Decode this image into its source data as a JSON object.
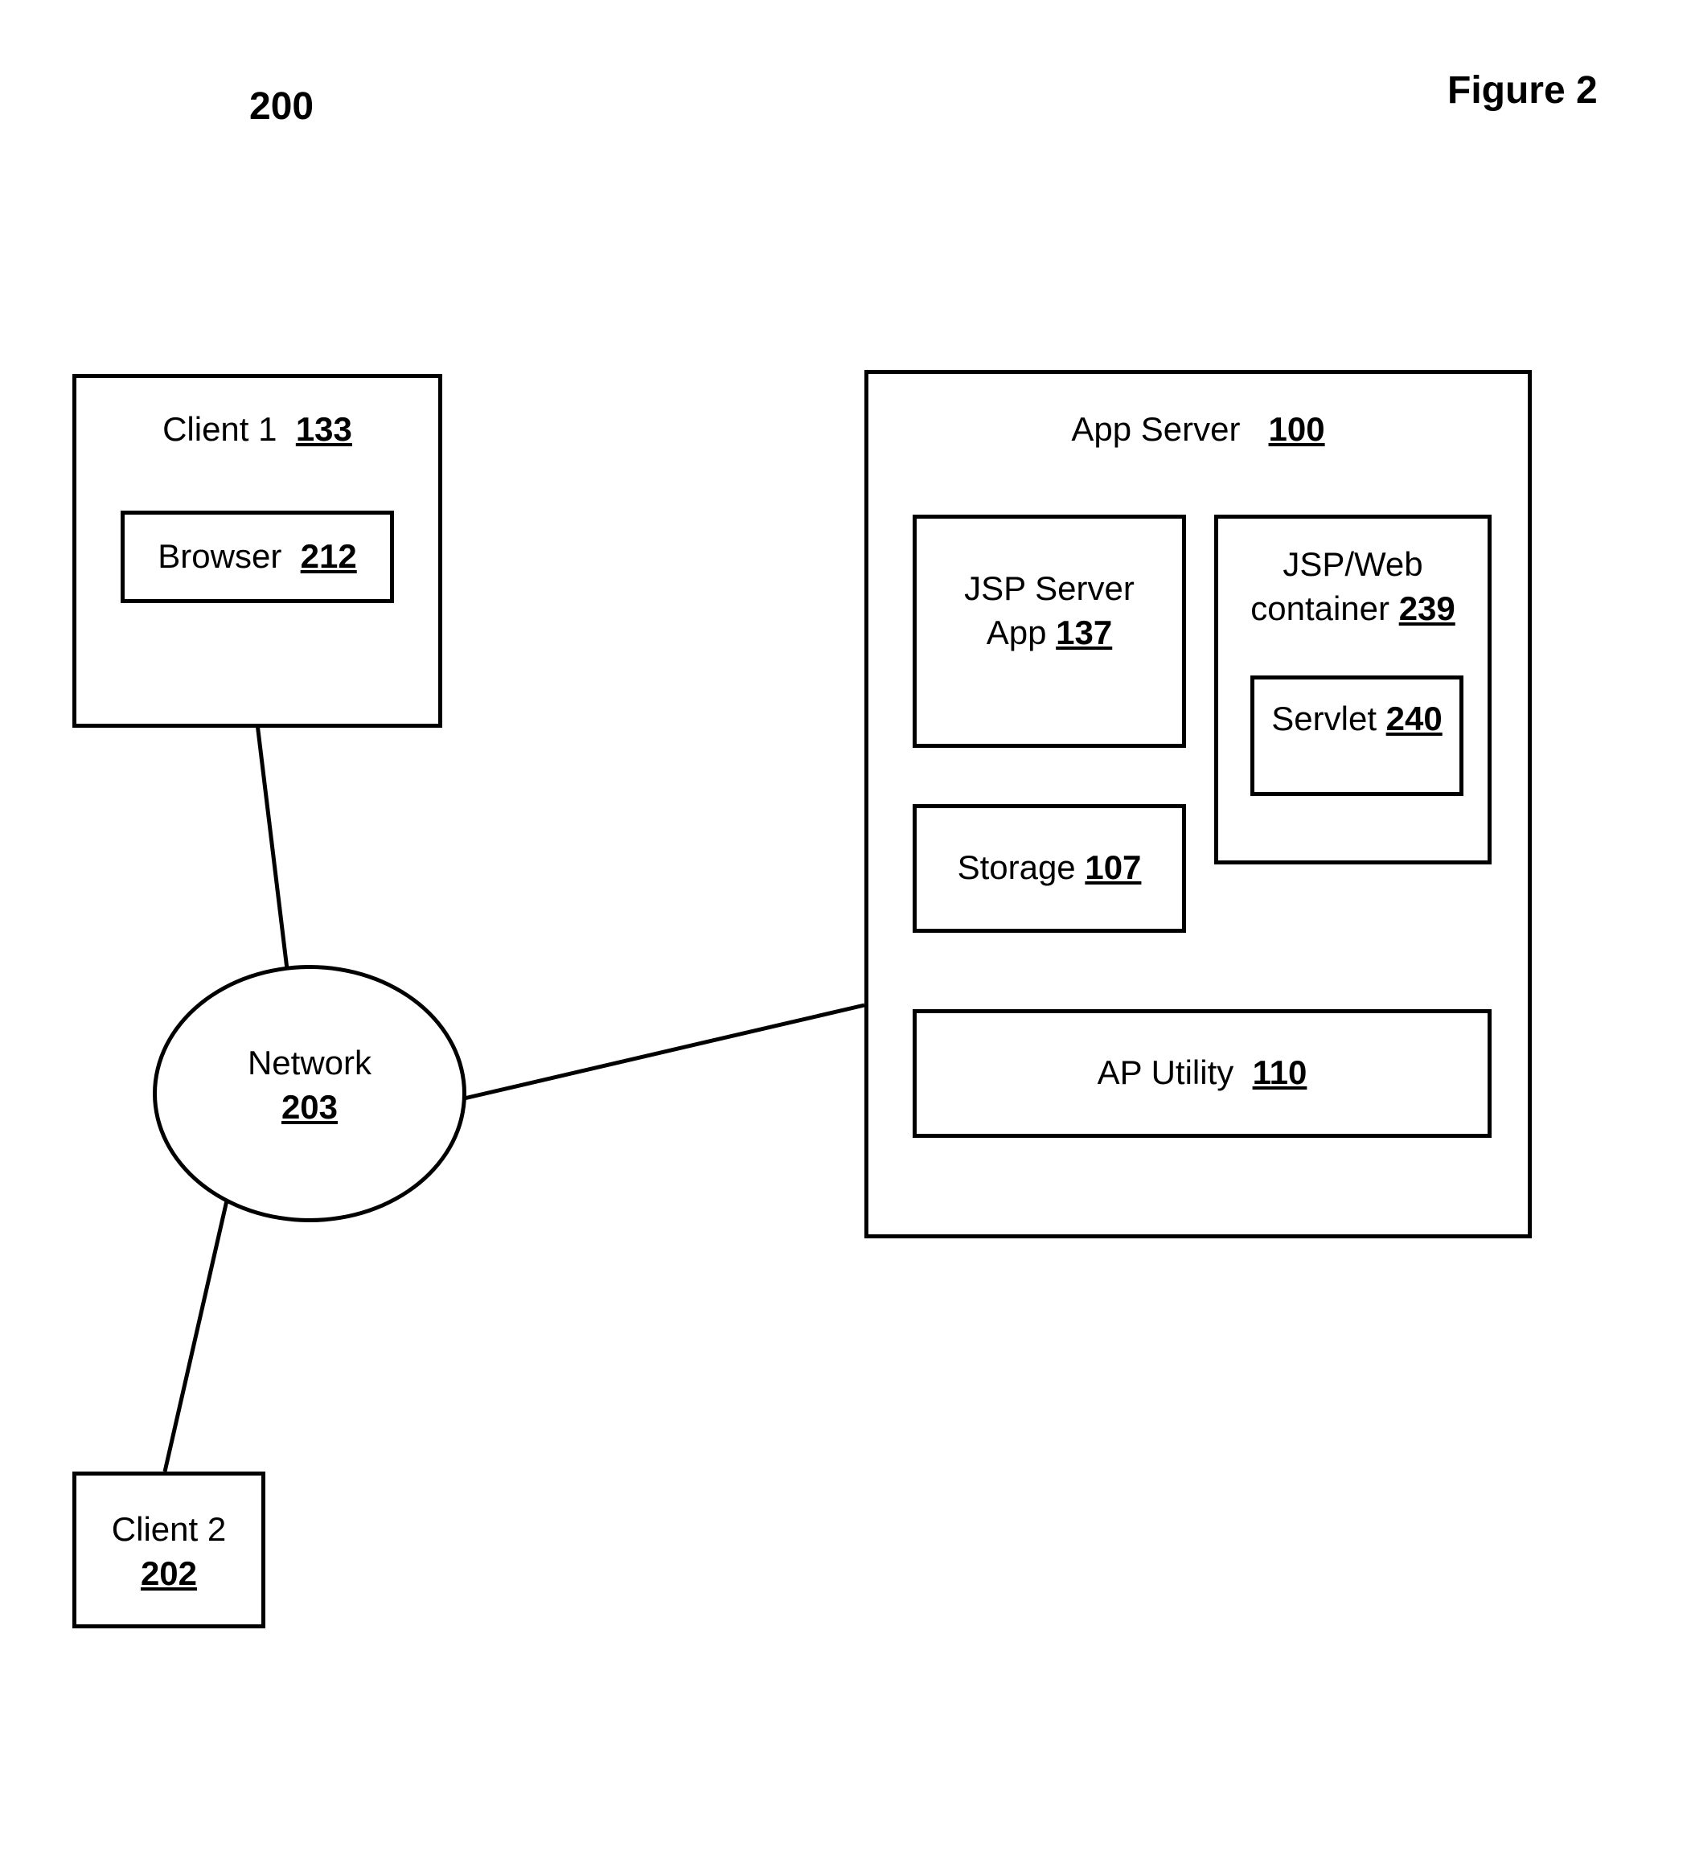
{
  "figure_number_label": "200",
  "figure_title": "Figure 2",
  "client1": {
    "title": "Client 1",
    "num": "133"
  },
  "browser": {
    "title": "Browser",
    "num": "212"
  },
  "network": {
    "title": "Network",
    "num": "203"
  },
  "client2": {
    "title": "Client 2",
    "num": "202"
  },
  "app_server": {
    "title": "App Server",
    "num": "100"
  },
  "jsp_server": {
    "line1": "JSP Server",
    "line2": "App",
    "num": "137"
  },
  "jsp_web": {
    "line1": "JSP/Web",
    "line2": "container",
    "num": "239"
  },
  "servlet": {
    "title": "Servlet",
    "num": "240"
  },
  "storage": {
    "title": "Storage",
    "num": "107"
  },
  "ap_utility": {
    "title": "AP Utility",
    "num": "110"
  }
}
